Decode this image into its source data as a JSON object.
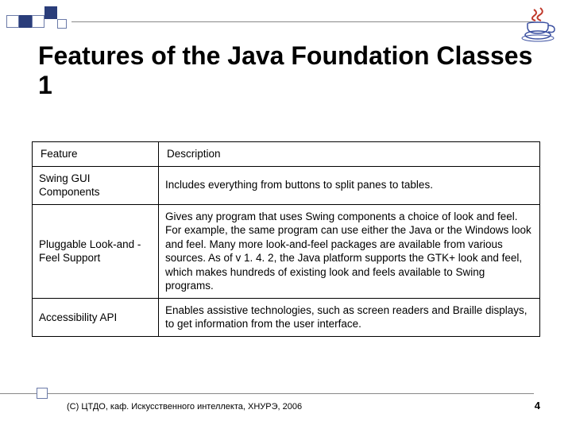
{
  "title": "Features of the Java Foundation Classes 1",
  "table": {
    "header": {
      "feature": "Feature",
      "description": "Description"
    },
    "rows": [
      {
        "feature": "Swing GUI Components",
        "description": "Includes everything from buttons to split panes to tables."
      },
      {
        "feature": "Pluggable Look-and -Feel Support",
        "description": "Gives any program that uses Swing components a choice of look and feel. For example, the same program can use either the Java or the Windows look and feel. Many more look-and-feel packages are available from various sources. As of v 1. 4. 2, the Java platform supports the GTK+ look and feel, which makes hundreds of existing look and feels available to Swing programs."
      },
      {
        "feature": "Accessibility API",
        "description": "Enables assistive technologies, such as screen readers and Braille displays, to get information from the user interface."
      }
    ]
  },
  "footer": {
    "copyright": "(С) ЦТДО, каф. Искусственного интеллекта, ХНУРЭ, 2006",
    "page": "4"
  }
}
